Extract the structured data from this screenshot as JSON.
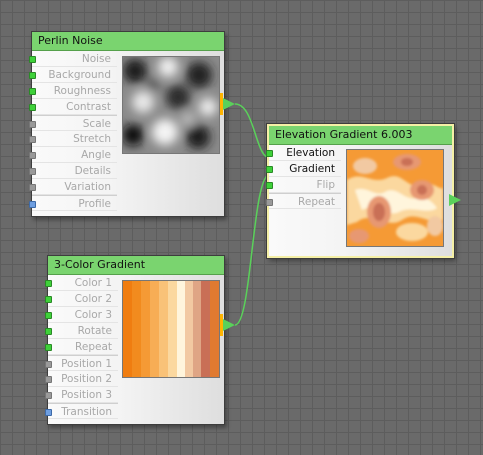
{
  "perlin": {
    "title": "Perlin Noise",
    "ports": [
      "Noise",
      "Background",
      "Roughness",
      "Contrast",
      "Scale",
      "Stretch",
      "Angle",
      "Details",
      "Variation",
      "Profile"
    ]
  },
  "gradient3": {
    "title": "3-Color Gradient",
    "ports": [
      "Color 1",
      "Color 2",
      "Color 3",
      "Rotate",
      "Repeat",
      "Position 1",
      "Position 2",
      "Position 3",
      "Transition"
    ]
  },
  "elevation": {
    "title": "Elevation Gradient 6.003",
    "ports": [
      "Elevation",
      "Gradient",
      "Flip",
      "Repeat"
    ]
  },
  "colors": {
    "node_header": "#7ad46f",
    "wire": "#5ad15a",
    "connected_port": "#3fd13a",
    "output_bar": "#ffb400",
    "selection": "#f5f0a6"
  }
}
